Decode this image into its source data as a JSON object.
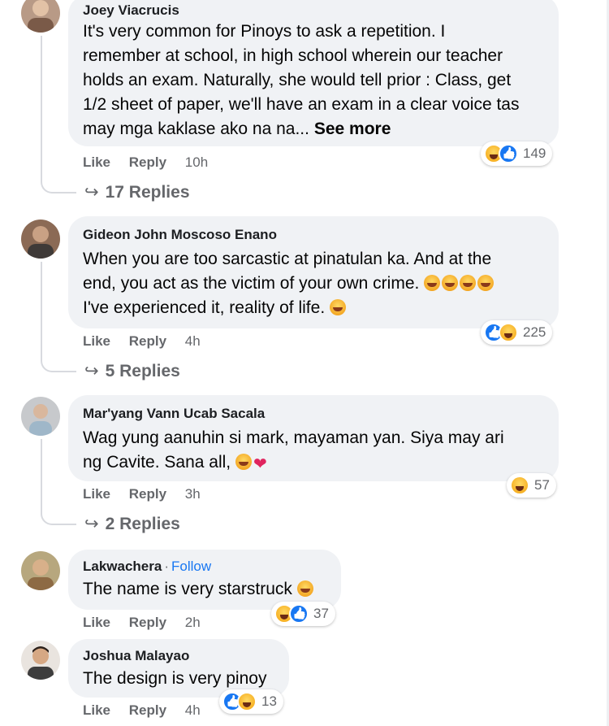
{
  "comments": [
    {
      "author": "Joey Viacrucis",
      "lines": [
        "It's very common for Pinoys to ask a repetition. I",
        "remember at school, in high school wherein our teacher",
        "holds an exam. Naturally, she would tell prior : Class, get",
        "1/2 sheet of paper, we'll have an exam in a clear voice tas"
      ],
      "last_line": "may mga kaklase ako na na...",
      "see_more": "See more",
      "like": "Like",
      "reply": "Reply",
      "time": "10h",
      "reaction_icons": [
        "haha",
        "like"
      ],
      "reaction_count": "149",
      "replies": "17 Replies"
    },
    {
      "author": "Gideon John Moscoso Enano",
      "lines": [
        "When you are too sarcastic at pinatulan ka. And at the",
        "end, you act as the victim of your own crime."
      ],
      "last_line": "I've experienced it, reality of life.",
      "like": "Like",
      "reply": "Reply",
      "time": "4h",
      "reaction_icons": [
        "like",
        "haha"
      ],
      "reaction_count": "225",
      "replies": "5 Replies"
    },
    {
      "author": "Mar'yang Vann Ucab Sacala",
      "lines": [
        "Wag yung aanuhin si mark, mayaman yan. Siya may ari"
      ],
      "last_line": "ng Cavite. Sana all,",
      "like": "Like",
      "reply": "Reply",
      "time": "3h",
      "reaction_icons": [
        "haha"
      ],
      "reaction_count": "57",
      "replies": "2 Replies"
    },
    {
      "author": "Lakwachera",
      "separator": "·",
      "follow": "Follow",
      "last_line": "The name is very starstruck",
      "like": "Like",
      "reply": "Reply",
      "time": "2h",
      "reaction_icons": [
        "haha",
        "like"
      ],
      "reaction_count": "37"
    },
    {
      "author": "Joshua Malayao",
      "last_line": "The design is very pinoy",
      "like": "Like",
      "reply": "Reply",
      "time": "4h",
      "reaction_icons": [
        "like",
        "haha"
      ],
      "reaction_count": "13"
    }
  ],
  "colors": {
    "bubble": "#f0f2f5",
    "action_text": "#65676b",
    "follow_link": "#1877f2",
    "like_blue": "#1877f2",
    "haha_yellow": "#f7b125"
  }
}
